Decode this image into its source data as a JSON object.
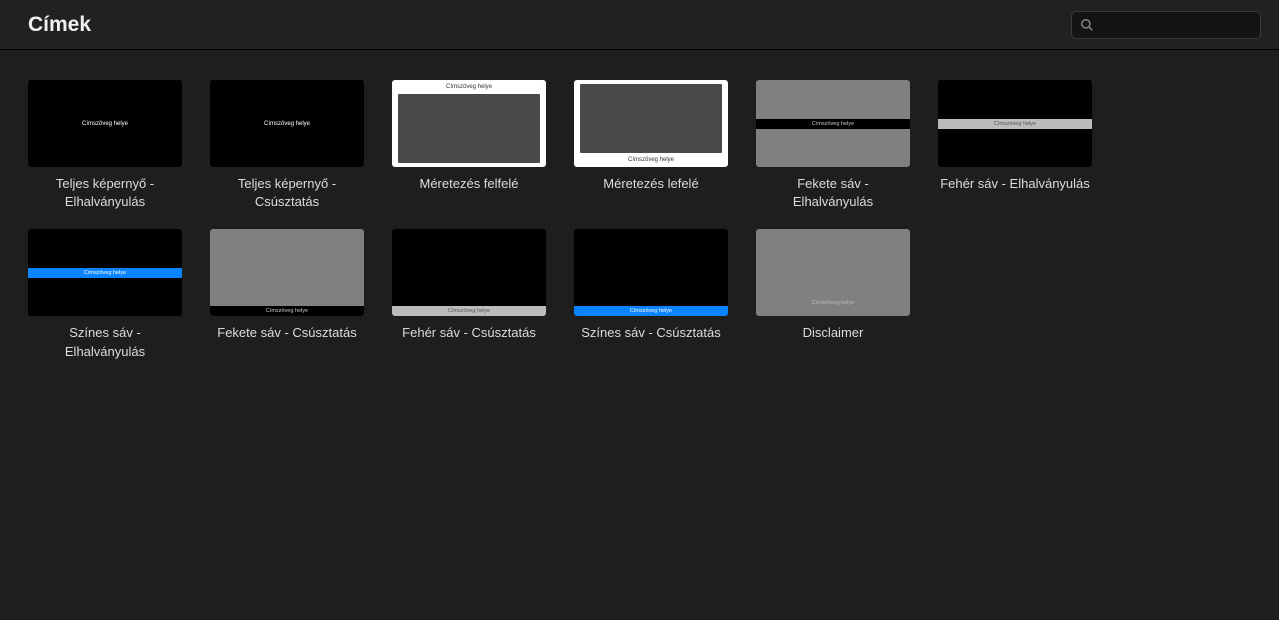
{
  "header": {
    "title": "Címek",
    "search_placeholder": ""
  },
  "placeholder_text": "Címszöveg helye",
  "tiles": [
    {
      "label": "Teljes képernyő - Elhalványulás"
    },
    {
      "label": "Teljes képernyő - Csúsztatás"
    },
    {
      "label": "Méretezés felfelé"
    },
    {
      "label": "Méretezés lefelé"
    },
    {
      "label": "Fekete sáv - Elhalványulás"
    },
    {
      "label": "Fehér sáv - Elhalványulás"
    },
    {
      "label": "Színes sáv - Elhalványulás"
    },
    {
      "label": "Fekete sáv - Csúsztatás"
    },
    {
      "label": "Fehér sáv - Csúsztatás"
    },
    {
      "label": "Színes sáv - Csúsztatás"
    },
    {
      "label": "Disclaimer"
    }
  ]
}
